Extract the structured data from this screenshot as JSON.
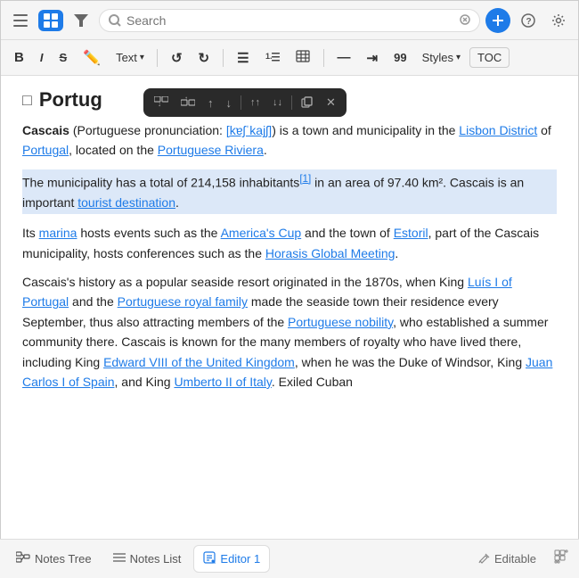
{
  "topToolbar": {
    "hamburgerIcon": "≡",
    "gridIcon": "⊞",
    "filterIcon": "⊟",
    "searchPlaceholder": "Search",
    "clearIcon": "✕",
    "addIcon": "+",
    "helpIcon": "?",
    "settingsIcon": "⚙"
  },
  "formatToolbar": {
    "bold": "B",
    "italic": "I",
    "strikethrough": "S",
    "highlight": "✏",
    "textLabel": "Text",
    "textDropdown": "▾",
    "undoIcon": "↺",
    "redoIcon": "↻",
    "bulletList": "☰",
    "numberedList": "☷",
    "tableIcon": "⊞",
    "dividerIcon": "—",
    "indentIcon": "⇥",
    "number99": "99",
    "stylesLabel": "Styles",
    "stylesDropdown": "▾",
    "tocLabel": "TOC"
  },
  "blockToolbar": {
    "buttons": [
      "⬆↓",
      "⇩↑",
      "↑",
      "↓",
      "↑↑",
      "↓↓",
      "⧉",
      "✕"
    ]
  },
  "page": {
    "icon": "□",
    "title": "Portug",
    "content": [
      {
        "id": "p1",
        "html": "<strong>Cascais</strong> (Portuguese pronunciation: <a href='#'>[kɐʃˈkajʃ]</a>) is a town and municipality in the <a href='#'>Lisbon District</a> of <a href='#'>Portugal</a>, located on the <a href='#'>Portuguese Riviera</a>."
      },
      {
        "id": "p2",
        "highlighted": true,
        "html": "The municipality has a total of 214,158 inhabitants<sup><a href='#'>[1]</a></sup> in an area of 97.40 km². Cascais is an important <a href='#'>tourist destination</a>."
      },
      {
        "id": "p3",
        "html": "Its <a href='#'>marina</a> hosts events such as the <a href='#'>America's Cup</a> and the town of <a href='#'>Estoril</a>, part of the Cascais municipality, hosts conferences such as the <a href='#'>Horasis Global Meeting</a>."
      },
      {
        "id": "p4",
        "html": "Cascais's history as a popular seaside resort originated in the 1870s, when King <a href='#'>Luís I of Portugal</a> and the <a href='#'>Portuguese royal family</a> made the seaside town their residence every September, thus also attracting members of the <a href='#'>Portuguese nobility</a>, who established a summer community there. Cascais is known for the many members of royalty who have lived there, including King <a href='#'>Edward VIII of the United Kingdom</a>, when he was the Duke of Windsor, King <a href='#'>Juan Carlos I of Spain</a>, and King <a href='#'>Umberto II of Italy</a>. Exiled Cuban"
      }
    ]
  },
  "bottomBar": {
    "notesTreeLabel": "Notes Tree",
    "notesListLabel": "Notes List",
    "editorLabel": "Editor 1",
    "editableLabel": "Editable"
  }
}
